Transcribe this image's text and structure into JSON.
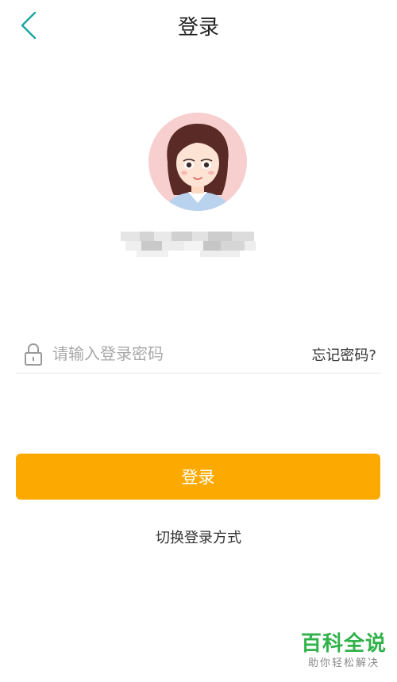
{
  "header": {
    "title": "登录",
    "back_icon": "chevron-left-icon",
    "accent_color": "#1aa6a0"
  },
  "avatar": {
    "icon": "user-avatar-illustration"
  },
  "password": {
    "placeholder": "请输入登录密码",
    "value": "",
    "lock_icon": "lock-icon",
    "forgot_label": "忘记密码?"
  },
  "login_button": {
    "label": "登录",
    "color": "#fcaa02"
  },
  "switch_method": {
    "label": "切换登录方式"
  },
  "watermark": {
    "main": "百科全说",
    "sub": "助你轻松解决",
    "color": "#2fb24a"
  }
}
